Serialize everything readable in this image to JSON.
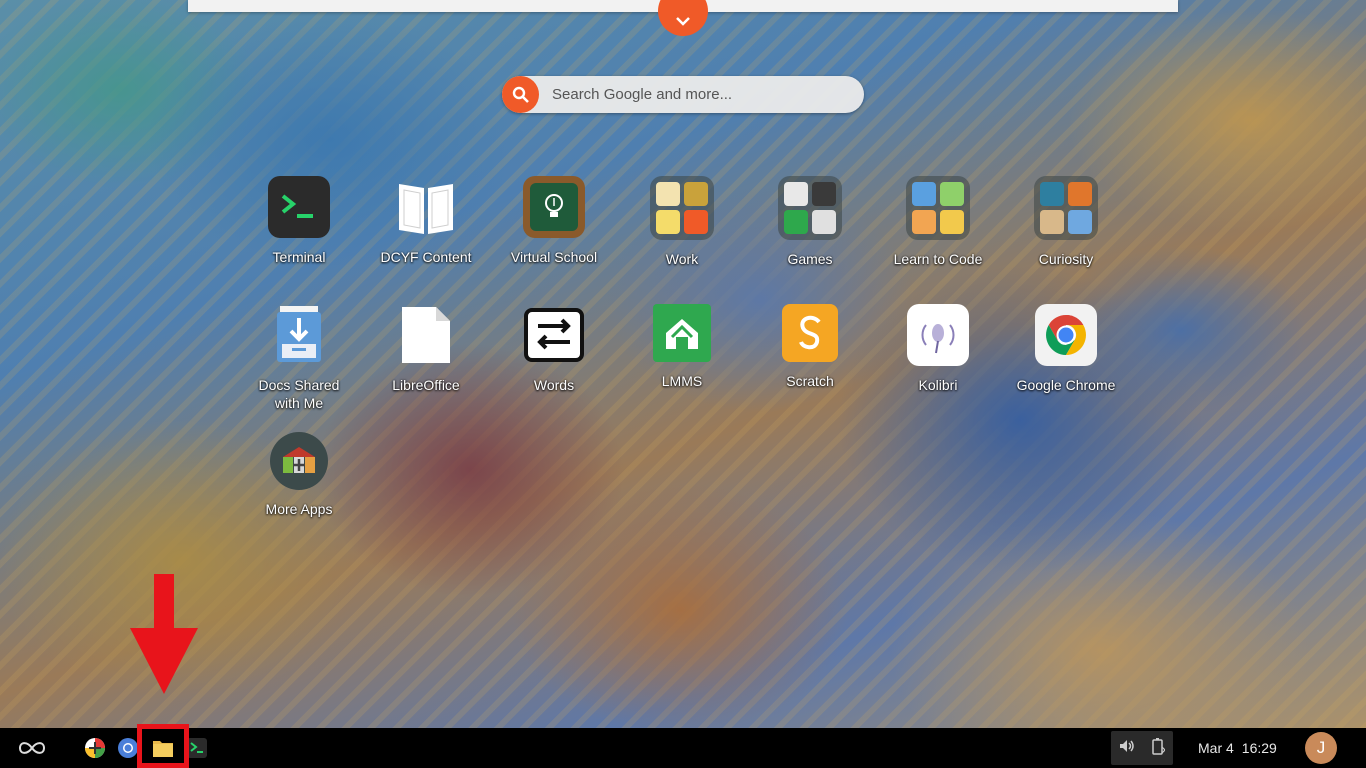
{
  "search": {
    "placeholder": "Search Google and more..."
  },
  "apps": [
    {
      "label": "Terminal",
      "icon": "terminal-icon"
    },
    {
      "label": "DCYF Content",
      "icon": "book-icon"
    },
    {
      "label": "Virtual School",
      "icon": "lightbulb-chalkboard-icon"
    },
    {
      "label": "Work",
      "icon": "folder-icon"
    },
    {
      "label": "Games",
      "icon": "folder-icon"
    },
    {
      "label": "Learn to Code",
      "icon": "folder-icon"
    },
    {
      "label": "Curiosity",
      "icon": "folder-icon"
    },
    {
      "label": "Docs Shared with Me",
      "icon": "shared-docs-icon"
    },
    {
      "label": "LibreOffice",
      "icon": "document-icon"
    },
    {
      "label": "Words",
      "icon": "words-icon"
    },
    {
      "label": "LMMS",
      "icon": "lmms-icon"
    },
    {
      "label": "Scratch",
      "icon": "scratch-icon"
    },
    {
      "label": "Kolibri",
      "icon": "kolibri-icon"
    },
    {
      "label": "Google Chrome",
      "icon": "chrome-icon"
    },
    {
      "label": "More Apps",
      "icon": "app-center-icon"
    }
  ],
  "shelf": {
    "items": [
      "app-center-icon",
      "chrome-icon",
      "files-icon",
      "terminal-icon"
    ],
    "date": "Mar 4",
    "time": "16:29",
    "user_initial": "J"
  },
  "colors": {
    "accent": "#f05a28",
    "highlight": "#e8141b",
    "shelf": "#000000"
  }
}
